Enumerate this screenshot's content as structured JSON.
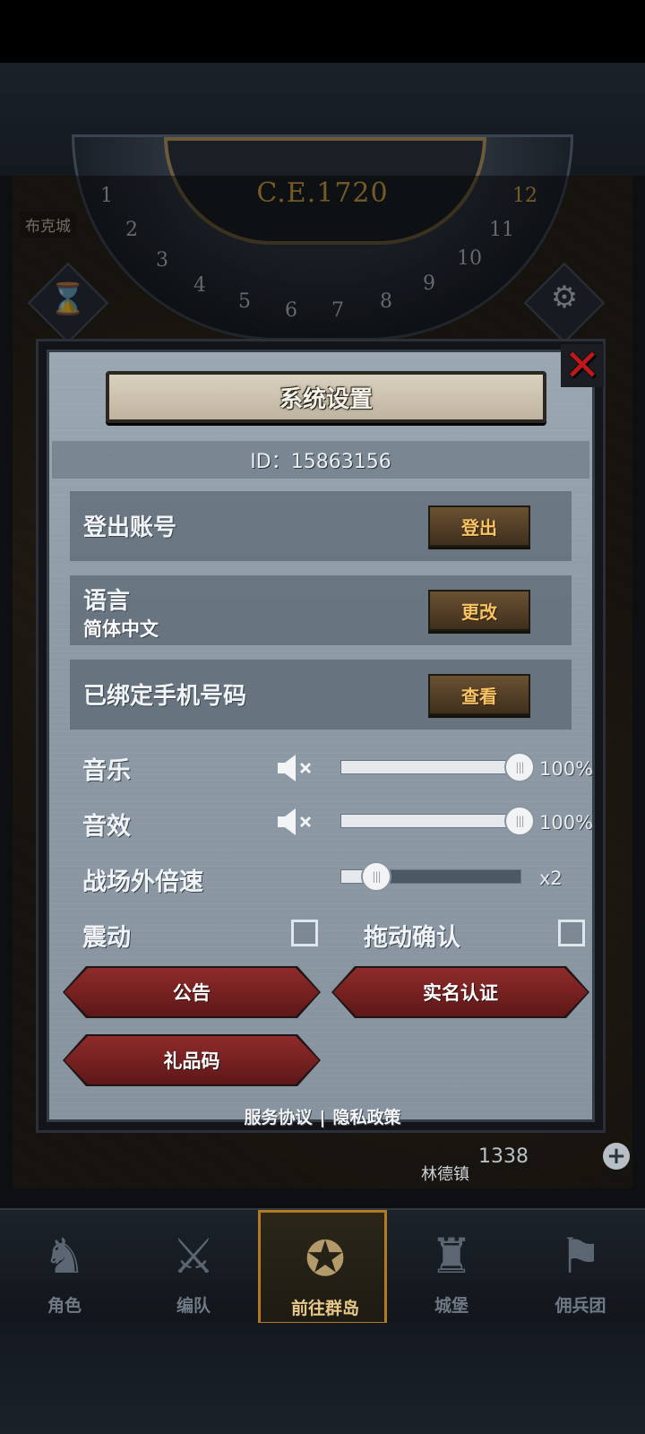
{
  "background": {
    "era": "C.E.1720",
    "dial_numbers": [
      "1",
      "2",
      "3",
      "4",
      "5",
      "6",
      "7",
      "8",
      "9",
      "10",
      "11",
      "12"
    ],
    "town_left": "布克城",
    "town_bottom": "林德镇",
    "coins": "1338"
  },
  "settings": {
    "title": "系统设置",
    "id_label": "ID：15863156",
    "rows": [
      {
        "label": "登出账号",
        "button": "登出"
      },
      {
        "label": "语言",
        "sub": "简体中文",
        "button": "更改"
      },
      {
        "label": "已绑定手机号码",
        "button": "查看"
      }
    ],
    "music": {
      "label": "音乐",
      "value": 1.0,
      "value_text": "100%"
    },
    "sfx": {
      "label": "音效",
      "value": 1.0,
      "value_text": "100%"
    },
    "speed": {
      "label": "战场外倍速",
      "value": 0.2,
      "value_text": "x2"
    },
    "vibrate": {
      "label": "震动",
      "checked": false
    },
    "drag_confirm": {
      "label": "拖动确认",
      "checked": false
    },
    "buttons": {
      "notice": "公告",
      "realname": "实名认证",
      "gift": "礼品码"
    },
    "links": {
      "terms": "服务协议",
      "sep": "|",
      "privacy": "隐私政策"
    }
  },
  "nav": [
    {
      "label": "角色",
      "icon": "knight-icon",
      "active": false
    },
    {
      "label": "编队",
      "icon": "team-icon",
      "active": false
    },
    {
      "label": "前往群岛",
      "icon": "compass-map-icon",
      "active": true
    },
    {
      "label": "城堡",
      "icon": "castle-icon",
      "active": false
    },
    {
      "label": "佣兵团",
      "icon": "mercenary-icon",
      "active": false
    }
  ],
  "colors": {
    "accent_gold": "#f8c364",
    "close_red": "#c01818",
    "nav_active_border": "#b27b22"
  }
}
